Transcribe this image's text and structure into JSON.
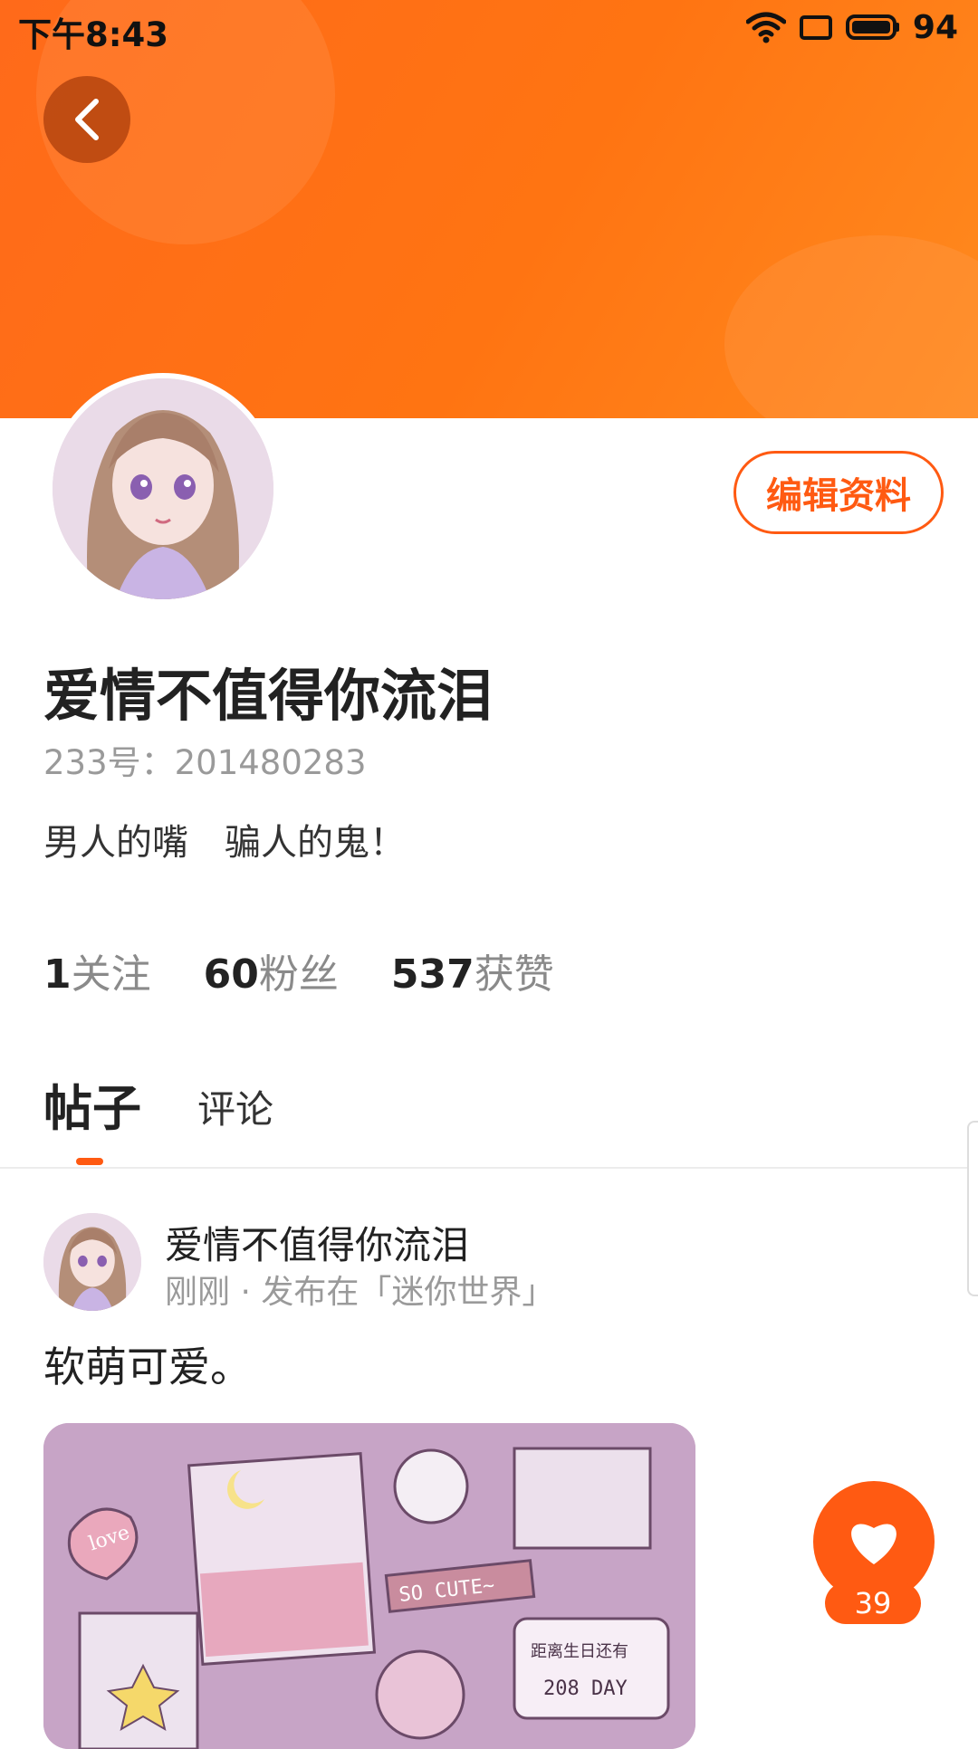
{
  "status_bar": {
    "time": "下午8:43",
    "battery": "94"
  },
  "profile": {
    "username": "爱情不值得你流泪",
    "id_line": "233号：201480283",
    "bio": "男人的嘴　骗人的鬼！",
    "edit_label": "编辑资料",
    "stats": [
      {
        "value": "1",
        "label": "关注"
      },
      {
        "value": "60",
        "label": "粉丝"
      },
      {
        "value": "537",
        "label": "获赞"
      }
    ]
  },
  "tabs": [
    {
      "label": "帖子",
      "active": true
    },
    {
      "label": "评论",
      "active": false
    }
  ],
  "post": {
    "author": "爱情不值得你流泪",
    "meta": "刚刚 · 发布在「迷你世界」",
    "text": "软萌可爱。",
    "image_texts": {
      "love": "love",
      "cute": "SO CUTE~",
      "sign_line1": "距离生日还有",
      "sign_line2": "208 DAY"
    },
    "like_count": "39"
  },
  "colors": {
    "accent": "#ff5a12",
    "header_gradient_start": "#ff6a1a",
    "header_gradient_end": "#ff8a1e"
  }
}
